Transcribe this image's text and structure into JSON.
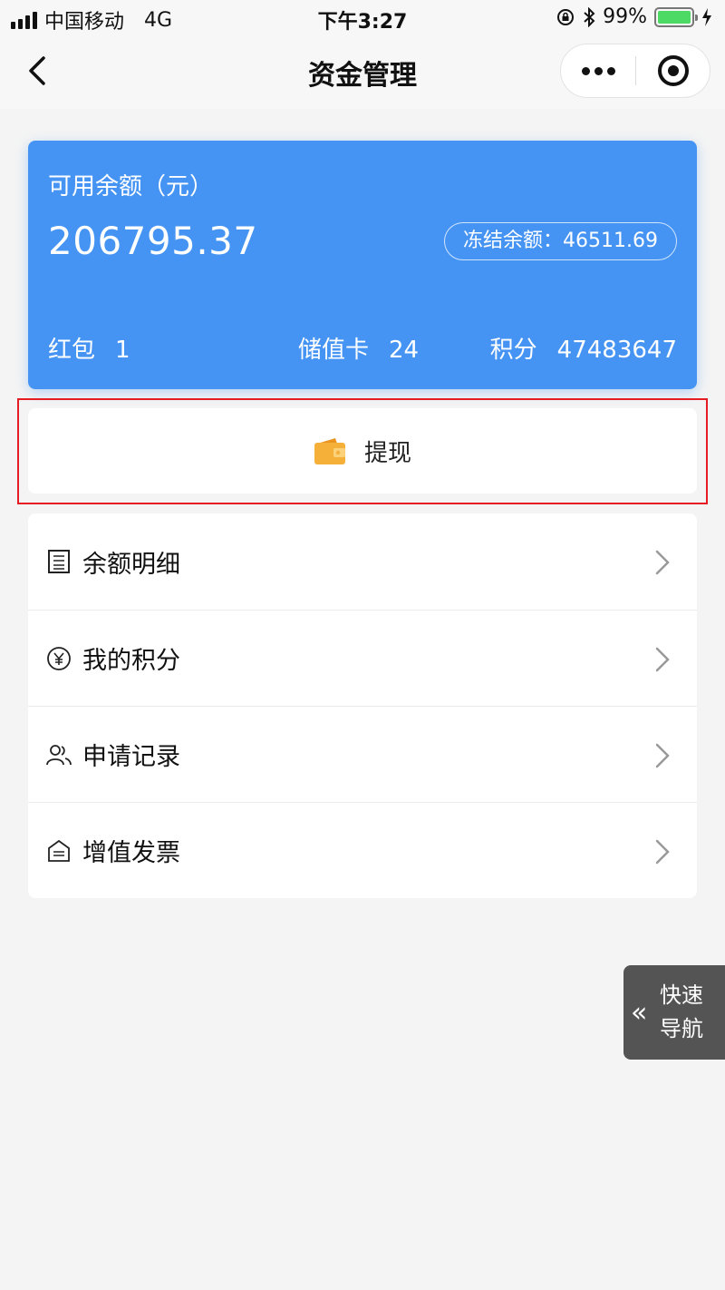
{
  "status_bar": {
    "carrier": "中国移动",
    "network": "4G",
    "time": "下午3:27",
    "battery": "99%",
    "battery_level": 0.99
  },
  "nav": {
    "title": "资金管理"
  },
  "balance_card": {
    "label": "可用余额（元）",
    "amount": "206795.37",
    "frozen": "冻结余额：46511.69",
    "stats": [
      {
        "label": "红包",
        "value": "1"
      },
      {
        "label": "储值卡",
        "value": "24"
      },
      {
        "label": "积分",
        "value": "47483647"
      }
    ]
  },
  "withdraw": {
    "label": "提现"
  },
  "menu": [
    {
      "label": "余额明细",
      "icon": "receipt-icon"
    },
    {
      "label": "我的积分",
      "icon": "yen-circle-icon"
    },
    {
      "label": "申请记录",
      "icon": "users-icon"
    },
    {
      "label": "增值发票",
      "icon": "invoice-icon"
    }
  ],
  "quick_nav": {
    "line1": "快速",
    "line2": "导航"
  },
  "colors": {
    "card": "#4594f4",
    "highlight": "#e51c23",
    "wallet": "#f5b03a"
  }
}
